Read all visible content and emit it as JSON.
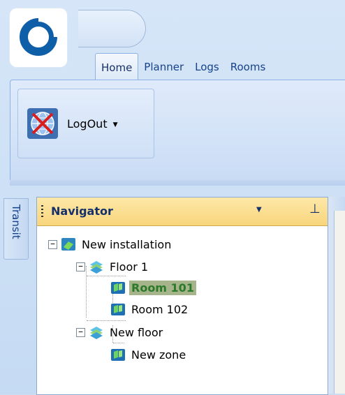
{
  "window": {
    "colors": {
      "accent": "#15428b",
      "selection": "#a5b48a",
      "header": "#f8d57c"
    }
  },
  "ribbon": {
    "tabs": [
      {
        "label": "Home",
        "active": true
      },
      {
        "label": "Planner",
        "active": false
      },
      {
        "label": "Logs",
        "active": false
      },
      {
        "label": "Rooms",
        "active": false
      }
    ],
    "logout_label": "LogOut",
    "logout_icon": "globe-cross-icon"
  },
  "sidepanel": {
    "transit_label": "Transit"
  },
  "navigator": {
    "title": "Navigator",
    "tree": {
      "root": {
        "label": "New installation",
        "icon": "installation-icon"
      },
      "floors": [
        {
          "label": "Floor 1",
          "icon": "floor-icon",
          "children": [
            {
              "label": "Room 101",
              "icon": "room-icon",
              "selected": true
            },
            {
              "label": "Room 102",
              "icon": "room-icon",
              "selected": false
            }
          ]
        },
        {
          "label": "New floor",
          "icon": "floor-icon",
          "children": [
            {
              "label": "New zone",
              "icon": "room-icon",
              "selected": false
            }
          ]
        }
      ]
    }
  }
}
